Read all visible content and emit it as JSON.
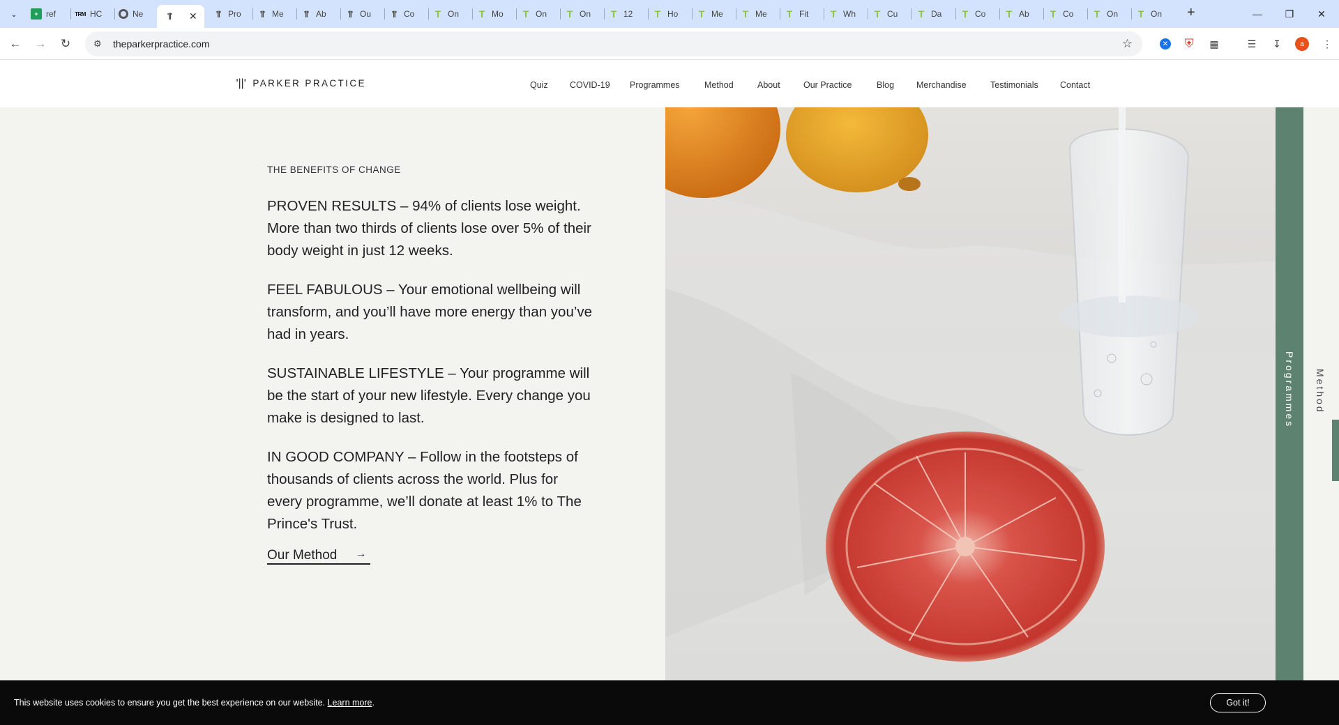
{
  "browser": {
    "tabs": [
      {
        "label": "ref",
        "icon": "sheets-icon"
      },
      {
        "label": "HC",
        "icon": "trm-icon"
      },
      {
        "label": "Ne",
        "icon": "chrome-icon"
      },
      {
        "label": "",
        "icon": "parker-icon",
        "active": true
      },
      {
        "label": "Pro",
        "icon": "parker-icon"
      },
      {
        "label": "Me",
        "icon": "parker-icon"
      },
      {
        "label": "Ab",
        "icon": "parker-icon"
      },
      {
        "label": "Ou",
        "icon": "parker-icon"
      },
      {
        "label": "Co",
        "icon": "parker-icon"
      },
      {
        "label": "On",
        "icon": "tree-icon"
      },
      {
        "label": "Mo",
        "icon": "tree-icon"
      },
      {
        "label": "On",
        "icon": "tree-icon"
      },
      {
        "label": "On",
        "icon": "tree-icon"
      },
      {
        "label": "12",
        "icon": "tree-icon"
      },
      {
        "label": "Ho",
        "icon": "tree-icon"
      },
      {
        "label": "Me",
        "icon": "tree-icon"
      },
      {
        "label": "Me",
        "icon": "tree-icon"
      },
      {
        "label": "Fit",
        "icon": "tree-icon"
      },
      {
        "label": "Wh",
        "icon": "tree-icon"
      },
      {
        "label": "Cu",
        "icon": "tree-icon"
      },
      {
        "label": "Da",
        "icon": "tree-icon"
      },
      {
        "label": "Co",
        "icon": "tree-icon"
      },
      {
        "label": "Ab",
        "icon": "tree-icon"
      },
      {
        "label": "Co",
        "icon": "tree-icon"
      },
      {
        "label": "On",
        "icon": "tree-icon"
      },
      {
        "label": "On",
        "icon": "tree-icon"
      }
    ],
    "url": "theparkerpractice.com",
    "profile_initial": "a"
  },
  "site": {
    "logo_mark": "'||'",
    "logo_text": "PARKER PRACTICE",
    "nav": [
      "Quiz",
      "COVID-19",
      "Programmes",
      "Method",
      "About",
      "Our Practice",
      "Blog",
      "Merchandise",
      "Testimonials",
      "Contact"
    ]
  },
  "main": {
    "kicker": "THE BENEFITS OF CHANGE",
    "paragraphs": [
      "PROVEN RESULTS – 94% of clients lose weight. More than two thirds of clients lose over 5% of their body weight in just 12 weeks.",
      "FEEL FABULOUS – Your emotional wellbeing will transform, and you’ll have more energy than you’ve had in years.",
      "SUSTAINABLE LIFESTYLE – Your programme will be the start of your new lifestyle. Every change you make is designed to last.",
      "IN GOOD COMPANY – Follow in the footsteps of thousands of clients across the world. Plus for every programme, we’ll donate at least 1% to The Prince's Trust."
    ],
    "cta_label": "Our Method",
    "cta_arrow": "→"
  },
  "side_tabs": {
    "programmes": "Programmes",
    "method": "Method"
  },
  "cookie": {
    "text": "This website uses cookies to ensure you get the best experience on our website.",
    "link": "Learn more",
    "suffix": ".",
    "button": "Got it!"
  },
  "colors": {
    "accent_green": "#5e8270",
    "cookie_bg": "#0a0a0a",
    "page_bg": "#f3f3f0"
  }
}
